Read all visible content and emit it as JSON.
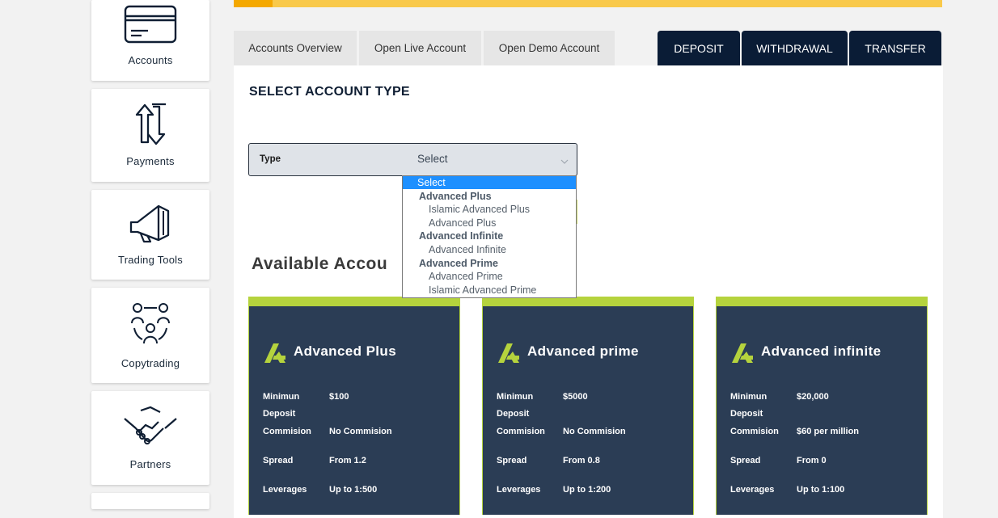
{
  "sidebar": {
    "items": [
      {
        "label": "Accounts",
        "icon": "credit-card-icon"
      },
      {
        "label": "Payments",
        "icon": "transfer-arrows-icon"
      },
      {
        "label": "Trading Tools",
        "icon": "megaphone-icon"
      },
      {
        "label": "Copytrading",
        "icon": "people-network-icon"
      },
      {
        "label": "Partners",
        "icon": "handshake-icon"
      }
    ]
  },
  "tabs": {
    "left": [
      "Accounts Overview",
      "Open Live Account",
      "Open Demo Account"
    ],
    "right": [
      "DEPOSIT",
      "WITHDRAWAL",
      "TRANSFER"
    ]
  },
  "form": {
    "title": "SELECT ACCOUNT TYPE",
    "type_label": "Type",
    "type_value": "Select"
  },
  "dropdown": {
    "selected": "Select",
    "groups": [
      {
        "label": "Advanced Plus",
        "options": [
          "Islamic Advanced Plus",
          "Advanced Plus"
        ]
      },
      {
        "label": "Advanced Infinite",
        "options": [
          "Advanced Infinite"
        ]
      },
      {
        "label": "Advanced Prime",
        "options": [
          "Advanced Prime",
          "Islamic Advanced Prime"
        ]
      }
    ]
  },
  "available": {
    "title": "Available Accou"
  },
  "accounts": [
    {
      "name": "Advanced Plus",
      "min_label_1": "Minimun",
      "min_label_2": "Deposit",
      "min_value": "$100",
      "commission_label": "Commision",
      "commission_value": "No Commision",
      "spread_label": "Spread",
      "spread_value": "From 1.2",
      "leverage_label": "Leverages",
      "leverage_value": "Up to 1:500"
    },
    {
      "name": "Advanced prime",
      "min_label_1": "Minimun",
      "min_label_2": "Deposit",
      "min_value": "$5000",
      "commission_label": "Commision",
      "commission_value": "No Commision",
      "spread_label": "Spread",
      "spread_value": "From 0.8",
      "leverage_label": "Leverages",
      "leverage_value": "Up to 1:200"
    },
    {
      "name": "Advanced infinite",
      "min_label_1": "Minimun",
      "min_label_2": "Deposit",
      "min_value": "$20,000",
      "commission_label": "Commision",
      "commission_value": "$60 per million",
      "spread_label": "Spread",
      "spread_value": "From 0",
      "leverage_label": "Leverages",
      "leverage_value": "Up to 1:100"
    }
  ],
  "colors": {
    "accent_yellow": "#f9c94a",
    "accent_orange": "#f4a800",
    "navy": "#0a1c36",
    "card_bg": "#2b3d55",
    "card_green": "#b5d33d",
    "select_blue": "#1e90ff"
  }
}
